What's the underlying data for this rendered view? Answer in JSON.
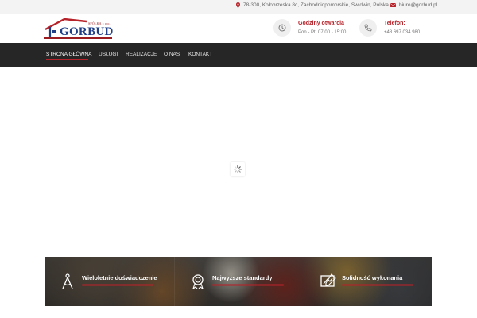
{
  "topbar": {
    "address": "78-300, Kołobrzeska 8c, Zachodniopomorskie, Świdwin, Polska",
    "email": "biuro@gorbud.pl"
  },
  "logo": {
    "brand": "GORBUD",
    "tagline": "SPÓŁKA z o.o."
  },
  "header": {
    "hours_title": "Godziny otwarcia",
    "hours_value": "Pon - Pt: 07:00 - 15:00",
    "phone_title": "Telefon:",
    "phone_value": "+48 697 034 980"
  },
  "nav": {
    "items": [
      {
        "label": "STRONA GŁÓWNA"
      },
      {
        "label": "USŁUGI"
      },
      {
        "label": "REALIZACJE"
      },
      {
        "label": "O NAS"
      },
      {
        "label": "KONTAKT"
      }
    ],
    "active_index": 0
  },
  "features": [
    {
      "title": "Wieloletnie doświadczenie",
      "icon": "compass-icon"
    },
    {
      "title": "Najwyższe standardy",
      "icon": "award-icon"
    },
    {
      "title": "Solidność wykonania",
      "icon": "blueprint-icon"
    }
  ],
  "colors": {
    "accent": "#b7232a",
    "brand_blue": "#1f3f87",
    "nav_bg": "#262626"
  }
}
